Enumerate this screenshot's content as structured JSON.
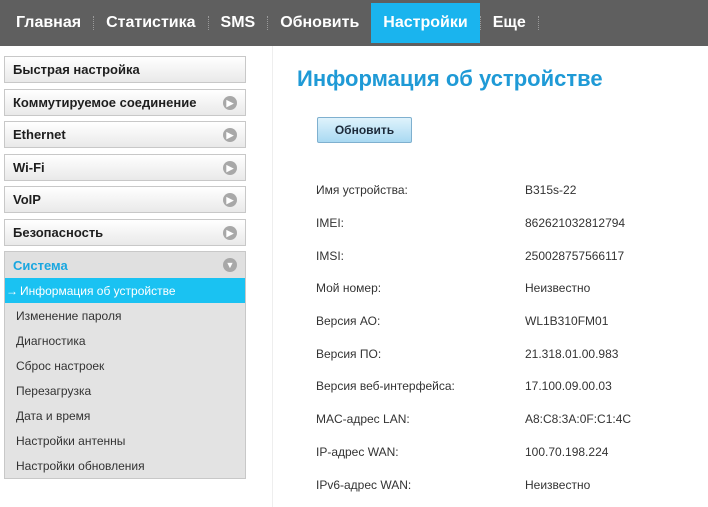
{
  "nav": {
    "items": [
      {
        "label": "Главная",
        "active": false
      },
      {
        "label": "Статистика",
        "active": false
      },
      {
        "label": "SMS",
        "active": false
      },
      {
        "label": "Обновить",
        "active": false
      },
      {
        "label": "Настройки",
        "active": true
      },
      {
        "label": "Еще",
        "active": false
      }
    ]
  },
  "sidebar": {
    "items": [
      {
        "label": "Быстрая настройка"
      },
      {
        "label": "Коммутируемое соединение"
      },
      {
        "label": "Ethernet"
      },
      {
        "label": "Wi-Fi"
      },
      {
        "label": "VoIP"
      },
      {
        "label": "Безопасность"
      },
      {
        "label": "Система"
      }
    ],
    "system_submenu": [
      {
        "label": "Информация об устройстве",
        "active": true
      },
      {
        "label": "Изменение пароля"
      },
      {
        "label": "Диагностика"
      },
      {
        "label": "Сброс настроек"
      },
      {
        "label": "Перезагрузка"
      },
      {
        "label": "Дата и время"
      },
      {
        "label": "Настройки антенны"
      },
      {
        "label": "Настройки обновления"
      }
    ],
    "active_arrow": "→"
  },
  "main": {
    "title": "Информация об устройстве",
    "refresh_label": "Обновить",
    "rows": [
      {
        "label": "Имя устройства:",
        "value": "B315s-22"
      },
      {
        "label": "IMEI:",
        "value": "862621032812794"
      },
      {
        "label": "IMSI:",
        "value": "250028757566117"
      },
      {
        "label": "Мой номер:",
        "value": "Неизвестно"
      },
      {
        "label": "Версия АО:",
        "value": "WL1B310FM01"
      },
      {
        "label": "Версия ПО:",
        "value": "21.318.01.00.983"
      },
      {
        "label": "Версия веб-интерфейса:",
        "value": "17.100.09.00.03"
      },
      {
        "label": "MAC-адрес LAN:",
        "value": "A8:C8:3A:0F:C1:4C"
      },
      {
        "label": "IP-адрес WAN:",
        "value": "100.70.198.224"
      },
      {
        "label": "IPv6-адрес WAN:",
        "value": "Неизвестно"
      }
    ]
  },
  "icons": {
    "chevron_right": "chevron-right-icon",
    "chevron_down": "chevron-down-icon"
  },
  "colors": {
    "nav_bg": "#5f5f5f",
    "accent": "#1ab4ee",
    "title": "#1f9ad6"
  }
}
